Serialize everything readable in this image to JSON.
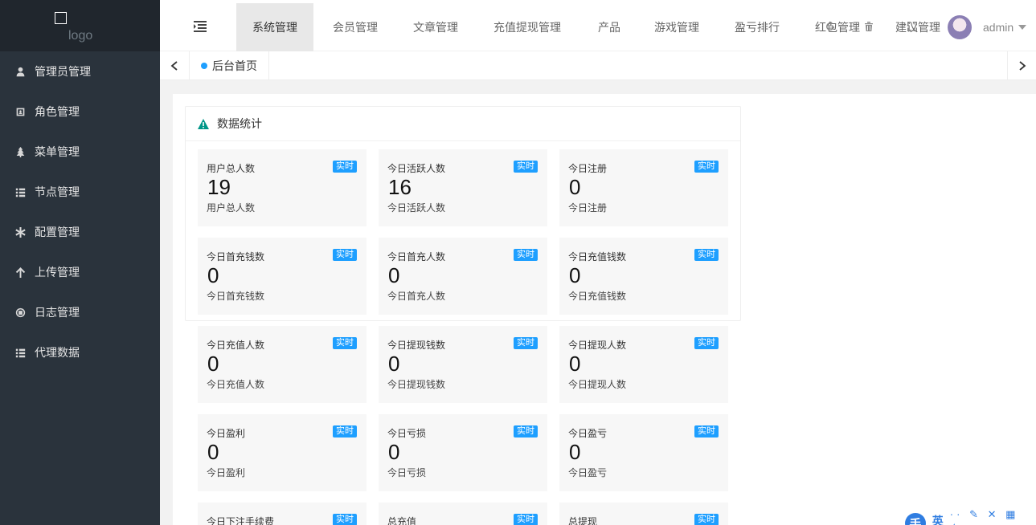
{
  "sidebar": {
    "logo_text": "logo",
    "items": [
      {
        "label": "管理员管理",
        "icon": "user-icon"
      },
      {
        "label": "角色管理",
        "icon": "id-card-icon"
      },
      {
        "label": "菜单管理",
        "icon": "tree-icon"
      },
      {
        "label": "节点管理",
        "icon": "list-icon"
      },
      {
        "label": "配置管理",
        "icon": "asterisk-icon"
      },
      {
        "label": "上传管理",
        "icon": "arrow-up-icon"
      },
      {
        "label": "日志管理",
        "icon": "bug-icon"
      },
      {
        "label": "代理数据",
        "icon": "list-icon"
      }
    ]
  },
  "header": {
    "nav": [
      "系统管理",
      "会员管理",
      "文章管理",
      "充值提现管理",
      "产品",
      "游戏管理",
      "盈亏排行",
      "红包管理",
      "建议管理"
    ],
    "active_index": 0,
    "user_name": "admin"
  },
  "tabs": {
    "home_label": "后台首页"
  },
  "panel": {
    "title": "数据统计",
    "badge_label": "实时",
    "cards": [
      {
        "title": "用户总人数",
        "value": "19",
        "sub": "用户总人数"
      },
      {
        "title": "今日活跃人数",
        "value": "16",
        "sub": "今日活跃人数"
      },
      {
        "title": "今日注册",
        "value": "0",
        "sub": "今日注册"
      },
      {
        "title": "今日首充钱数",
        "value": "0",
        "sub": "今日首充钱数"
      },
      {
        "title": "今日首充人数",
        "value": "0",
        "sub": "今日首充人数"
      },
      {
        "title": "今日充值钱数",
        "value": "0",
        "sub": "今日充值钱数"
      },
      {
        "title": "今日充值人数",
        "value": "0",
        "sub": "今日充值人数"
      },
      {
        "title": "今日提现钱数",
        "value": "0",
        "sub": "今日提现钱数"
      },
      {
        "title": "今日提现人数",
        "value": "0",
        "sub": "今日提现人数"
      },
      {
        "title": "今日盈利",
        "value": "0",
        "sub": "今日盈利"
      },
      {
        "title": "今日亏损",
        "value": "0",
        "sub": "今日亏损"
      },
      {
        "title": "今日盈亏",
        "value": "0",
        "sub": "今日盈亏"
      },
      {
        "title": "今日下注手续费",
        "value": "",
        "sub": ""
      },
      {
        "title": "总充值",
        "value": "",
        "sub": ""
      },
      {
        "title": "总提现",
        "value": "",
        "sub": ""
      }
    ]
  },
  "float_bar": {
    "chip": "手",
    "text": "英",
    "tools": "·· ✎ ✕ ▦ ✦"
  },
  "colors": {
    "sidebar_bg": "#2a333c",
    "logo_bg": "#20262d",
    "badge": "#1e9fff",
    "card_bg": "#f7f7f7",
    "warn_icon": "#009688"
  }
}
